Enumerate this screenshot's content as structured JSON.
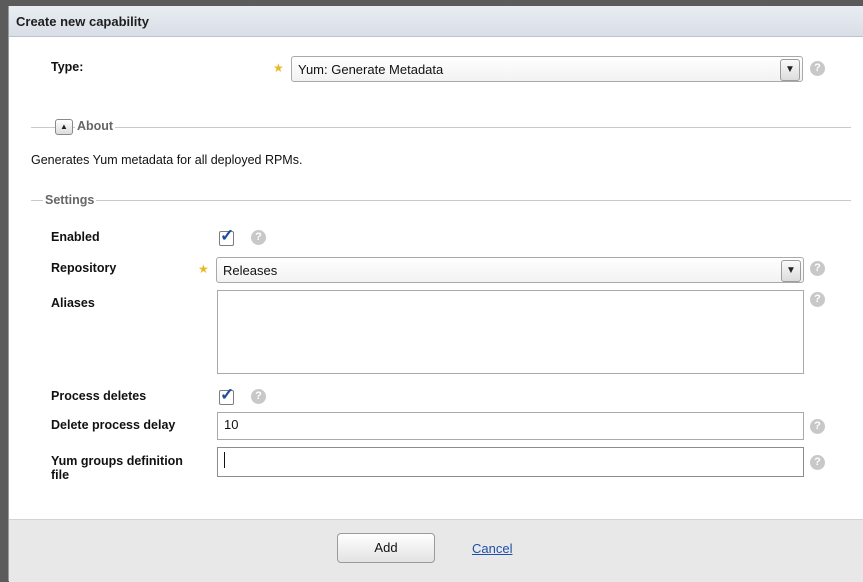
{
  "dialog": {
    "title": "Create new capability"
  },
  "type_field": {
    "label": "Type:",
    "value": "Yum: Generate Metadata",
    "required": true
  },
  "about": {
    "legend": "About",
    "collapsed": false,
    "text": "Generates Yum metadata for all deployed RPMs."
  },
  "settings": {
    "legend": "Settings",
    "enabled": {
      "label": "Enabled",
      "checked": true
    },
    "repository": {
      "label": "Repository",
      "value": "Releases",
      "required": true
    },
    "aliases": {
      "label": "Aliases",
      "value": ""
    },
    "process_deletes": {
      "label": "Process deletes",
      "checked": true
    },
    "delete_process_delay": {
      "label": "Delete process delay",
      "value": "10"
    },
    "yum_groups": {
      "label_line1": "Yum groups definition",
      "label_line2": "file",
      "value": ""
    }
  },
  "footer": {
    "add_label": "Add",
    "cancel_label": "Cancel"
  },
  "icons": {
    "help": "help-icon",
    "dropdown": "chevron-down-icon",
    "required": "required-star-icon",
    "collapse": "collapse-up-icon",
    "check": "checkmark-icon"
  },
  "colors": {
    "link": "#1f4fa8",
    "required_star": "#e8b924",
    "checkmark": "#1c4c9c"
  }
}
